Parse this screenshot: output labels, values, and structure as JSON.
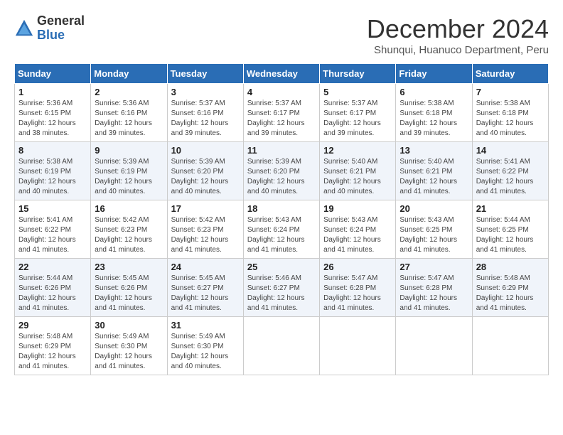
{
  "logo": {
    "general": "General",
    "blue": "Blue"
  },
  "title": "December 2024",
  "subtitle": "Shunqui, Huanuco Department, Peru",
  "weekdays": [
    "Sunday",
    "Monday",
    "Tuesday",
    "Wednesday",
    "Thursday",
    "Friday",
    "Saturday"
  ],
  "weeks": [
    [
      {
        "day": "1",
        "sunrise": "5:36 AM",
        "sunset": "6:15 PM",
        "daylight": "12 hours and 38 minutes."
      },
      {
        "day": "2",
        "sunrise": "5:36 AM",
        "sunset": "6:16 PM",
        "daylight": "12 hours and 39 minutes."
      },
      {
        "day": "3",
        "sunrise": "5:37 AM",
        "sunset": "6:16 PM",
        "daylight": "12 hours and 39 minutes."
      },
      {
        "day": "4",
        "sunrise": "5:37 AM",
        "sunset": "6:17 PM",
        "daylight": "12 hours and 39 minutes."
      },
      {
        "day": "5",
        "sunrise": "5:37 AM",
        "sunset": "6:17 PM",
        "daylight": "12 hours and 39 minutes."
      },
      {
        "day": "6",
        "sunrise": "5:38 AM",
        "sunset": "6:18 PM",
        "daylight": "12 hours and 39 minutes."
      },
      {
        "day": "7",
        "sunrise": "5:38 AM",
        "sunset": "6:18 PM",
        "daylight": "12 hours and 40 minutes."
      }
    ],
    [
      {
        "day": "8",
        "sunrise": "5:38 AM",
        "sunset": "6:19 PM",
        "daylight": "12 hours and 40 minutes."
      },
      {
        "day": "9",
        "sunrise": "5:39 AM",
        "sunset": "6:19 PM",
        "daylight": "12 hours and 40 minutes."
      },
      {
        "day": "10",
        "sunrise": "5:39 AM",
        "sunset": "6:20 PM",
        "daylight": "12 hours and 40 minutes."
      },
      {
        "day": "11",
        "sunrise": "5:39 AM",
        "sunset": "6:20 PM",
        "daylight": "12 hours and 40 minutes."
      },
      {
        "day": "12",
        "sunrise": "5:40 AM",
        "sunset": "6:21 PM",
        "daylight": "12 hours and 40 minutes."
      },
      {
        "day": "13",
        "sunrise": "5:40 AM",
        "sunset": "6:21 PM",
        "daylight": "12 hours and 41 minutes."
      },
      {
        "day": "14",
        "sunrise": "5:41 AM",
        "sunset": "6:22 PM",
        "daylight": "12 hours and 41 minutes."
      }
    ],
    [
      {
        "day": "15",
        "sunrise": "5:41 AM",
        "sunset": "6:22 PM",
        "daylight": "12 hours and 41 minutes."
      },
      {
        "day": "16",
        "sunrise": "5:42 AM",
        "sunset": "6:23 PM",
        "daylight": "12 hours and 41 minutes."
      },
      {
        "day": "17",
        "sunrise": "5:42 AM",
        "sunset": "6:23 PM",
        "daylight": "12 hours and 41 minutes."
      },
      {
        "day": "18",
        "sunrise": "5:43 AM",
        "sunset": "6:24 PM",
        "daylight": "12 hours and 41 minutes."
      },
      {
        "day": "19",
        "sunrise": "5:43 AM",
        "sunset": "6:24 PM",
        "daylight": "12 hours and 41 minutes."
      },
      {
        "day": "20",
        "sunrise": "5:43 AM",
        "sunset": "6:25 PM",
        "daylight": "12 hours and 41 minutes."
      },
      {
        "day": "21",
        "sunrise": "5:44 AM",
        "sunset": "6:25 PM",
        "daylight": "12 hours and 41 minutes."
      }
    ],
    [
      {
        "day": "22",
        "sunrise": "5:44 AM",
        "sunset": "6:26 PM",
        "daylight": "12 hours and 41 minutes."
      },
      {
        "day": "23",
        "sunrise": "5:45 AM",
        "sunset": "6:26 PM",
        "daylight": "12 hours and 41 minutes."
      },
      {
        "day": "24",
        "sunrise": "5:45 AM",
        "sunset": "6:27 PM",
        "daylight": "12 hours and 41 minutes."
      },
      {
        "day": "25",
        "sunrise": "5:46 AM",
        "sunset": "6:27 PM",
        "daylight": "12 hours and 41 minutes."
      },
      {
        "day": "26",
        "sunrise": "5:47 AM",
        "sunset": "6:28 PM",
        "daylight": "12 hours and 41 minutes."
      },
      {
        "day": "27",
        "sunrise": "5:47 AM",
        "sunset": "6:28 PM",
        "daylight": "12 hours and 41 minutes."
      },
      {
        "day": "28",
        "sunrise": "5:48 AM",
        "sunset": "6:29 PM",
        "daylight": "12 hours and 41 minutes."
      }
    ],
    [
      {
        "day": "29",
        "sunrise": "5:48 AM",
        "sunset": "6:29 PM",
        "daylight": "12 hours and 41 minutes."
      },
      {
        "day": "30",
        "sunrise": "5:49 AM",
        "sunset": "6:30 PM",
        "daylight": "12 hours and 41 minutes."
      },
      {
        "day": "31",
        "sunrise": "5:49 AM",
        "sunset": "6:30 PM",
        "daylight": "12 hours and 40 minutes."
      },
      null,
      null,
      null,
      null
    ]
  ]
}
